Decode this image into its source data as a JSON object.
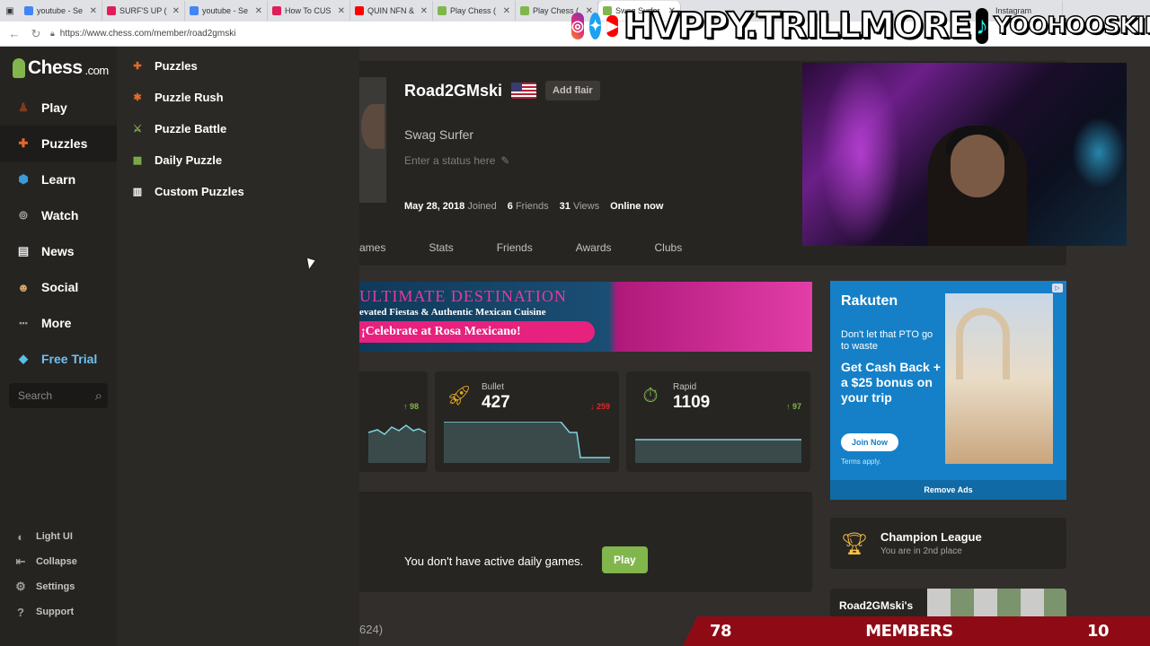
{
  "browser": {
    "tabs": [
      {
        "label": "youtube - Se",
        "color": "#4285f4"
      },
      {
        "label": "SURF'S UP (",
        "color": "#e01e5a"
      },
      {
        "label": "youtube - Se",
        "color": "#4285f4"
      },
      {
        "label": "How To CUS",
        "color": "#e01e5a"
      },
      {
        "label": "QUIN NFN &",
        "color": "#ff0000"
      },
      {
        "label": "Play Chess (",
        "color": "#81b64c"
      },
      {
        "label": "Play Chess (",
        "color": "#81b64c"
      },
      {
        "label": "Swag Surfer",
        "color": "#81b64c"
      }
    ],
    "tab_instagram": "Instagram",
    "url": "https://www.chess.com/member/road2gmski"
  },
  "overlay": {
    "handle_main": "HVPPY.TRILLMORE",
    "handle_secondary": "YOOHOOSKIN",
    "members_left": "78",
    "members_label": "MEMBERS",
    "members_right": "10"
  },
  "sidebar": {
    "logo": "Chess",
    "logo_suffix": ".com",
    "items": [
      {
        "label": "Play",
        "icon": "pawn-hand-icon",
        "color": "#7f3c1d"
      },
      {
        "label": "Puzzles",
        "icon": "puzzle-icon",
        "color": "#e36a2b"
      },
      {
        "label": "Learn",
        "icon": "learn-icon",
        "color": "#3c9ad6"
      },
      {
        "label": "Watch",
        "icon": "binoculars-icon",
        "color": "#9e9d9b"
      },
      {
        "label": "News",
        "icon": "newspaper-icon",
        "color": "#e5e5e5"
      },
      {
        "label": "Social",
        "icon": "people-icon",
        "color": "#d7a868"
      },
      {
        "label": "More",
        "icon": "ellipsis-icon",
        "color": "#9e9d9b"
      },
      {
        "label": "Free Trial",
        "icon": "diamond-icon",
        "color": "#5bbfe9"
      }
    ],
    "search_placeholder": "Search",
    "bottom": [
      {
        "label": "Light UI",
        "icon": "half-circle-icon"
      },
      {
        "label": "Collapse",
        "icon": "collapse-icon"
      },
      {
        "label": "Settings",
        "icon": "gear-icon"
      },
      {
        "label": "Support",
        "icon": "help-icon"
      }
    ]
  },
  "flyout": {
    "items": [
      {
        "label": "Puzzles",
        "color": "#e36a2b"
      },
      {
        "label": "Puzzle Rush",
        "color": "#e36a2b"
      },
      {
        "label": "Puzzle Battle",
        "color": "#81b64c"
      },
      {
        "label": "Daily Puzzle",
        "color": "#81b64c"
      },
      {
        "label": "Custom Puzzles",
        "color": "#ffffff"
      }
    ]
  },
  "profile": {
    "username": "Road2GMski",
    "add_flair": "Add flair",
    "title": "Swag Surfer",
    "status_placeholder": "Enter a status here",
    "joined_date": "May 28, 2018",
    "joined_label": "Joined",
    "friends_count": "6",
    "friends_label": "Friends",
    "views_count": "31",
    "views_label": "Views",
    "online": "Online now",
    "tabs": [
      "ames",
      "Stats",
      "Friends",
      "Awards",
      "Clubs"
    ]
  },
  "ad_banner": {
    "headline": "ULTIMATE DESTINATION",
    "sub": "evated Fiestas & Authentic Mexican Cuisine",
    "cta": "¡Celebrate at Rosa Mexicano!"
  },
  "ad_side": {
    "brand": "Rakuten",
    "small": "Don't let that PTO go to waste",
    "big": "Get Cash Back + a $25 bonus on your trip",
    "join": "Join Now",
    "terms": "Terms apply.",
    "remove": "Remove Ads"
  },
  "ratings": [
    {
      "label": "",
      "value": "",
      "delta": "98",
      "direction": "up"
    },
    {
      "label": "Bullet",
      "value": "427",
      "delta": "259",
      "direction": "down"
    },
    {
      "label": "Rapid",
      "value": "1109",
      "delta": "97",
      "direction": "up"
    }
  ],
  "daily": {
    "message": "You don't have active daily games.",
    "play": "Play"
  },
  "bottom_peek": "624)",
  "league": {
    "title": "Champion League",
    "place": "You are in 2nd place"
  },
  "club": {
    "name": "Road2GMski's"
  }
}
